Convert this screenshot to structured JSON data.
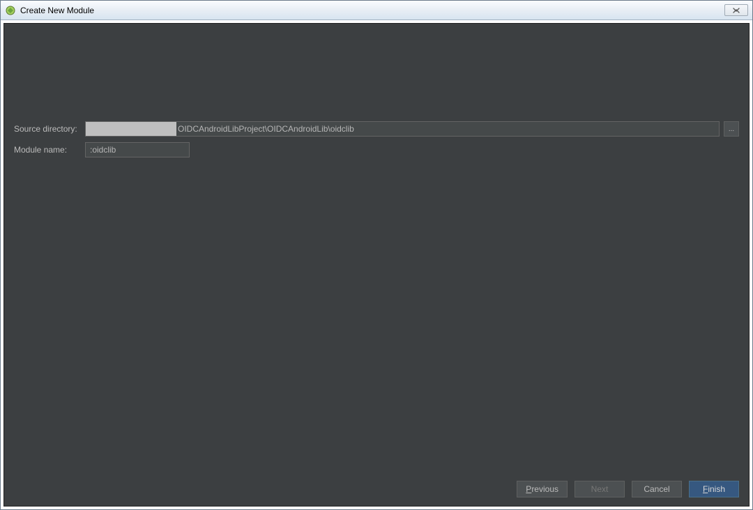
{
  "window": {
    "title": "Create New Module"
  },
  "form": {
    "source_directory_label": "Source directory:",
    "source_directory_value": "OIDCAndroidLibProject\\OIDCAndroidLib\\oidclib",
    "browse_label": "...",
    "module_name_label": "Module name:",
    "module_name_value": ":oidclib"
  },
  "buttons": {
    "previous_leading": "P",
    "previous_rest": "revious",
    "next": "Next",
    "cancel": "Cancel",
    "finish_leading": "F",
    "finish_rest": "inish"
  }
}
